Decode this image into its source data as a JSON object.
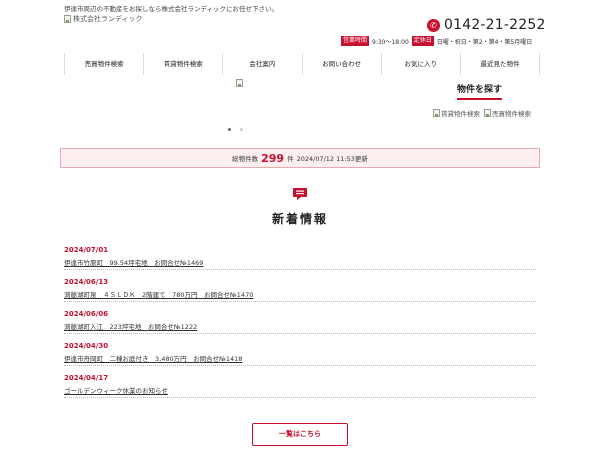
{
  "header": {
    "tagline": "伊達市周辺の不動産をお探しなら株式会社ランディックにお任せ下さい。",
    "logo_alt": "株式会社ランディック",
    "phone": "0142-21-2252",
    "hours_label": "営業時間",
    "hours": "9:30～18:00",
    "closed_label": "定休日",
    "closed_days": "日曜・祝日・第2・第4・第5月曜日"
  },
  "nav": {
    "items": [
      {
        "label": "売買物件検索"
      },
      {
        "label": "賃貸物件検索"
      },
      {
        "label": "会社案内"
      },
      {
        "label": "お問い合わせ"
      },
      {
        "label": "お気に入り"
      },
      {
        "label": "最近見た物件"
      }
    ]
  },
  "search": {
    "title": "物件を探す",
    "rental_link": "賃貸物件検索",
    "sale_link": "売買物件検索"
  },
  "summary": {
    "total_label": "総物件数",
    "total_count": "299",
    "unit": "件",
    "updated": "2024/07/12 11:53更新"
  },
  "news": {
    "title": "新着情報",
    "items": [
      {
        "date": "2024/07/01",
        "text": "伊達市竹原町　99.54坪宅地　お問合せ№1469"
      },
      {
        "date": "2024/06/13",
        "text": "洞爺湖町泉　４ＳＬＤＫ　2階建て　780万円　お問合せ№1470"
      },
      {
        "date": "2024/06/06",
        "text": "洞爺湖町入江　223坪宅地　お問合せ№1222"
      },
      {
        "date": "2024/04/30",
        "text": "伊達市舟岡町　二棟お庭付き　3,480万円　お問合せ№1418"
      },
      {
        "date": "2024/04/17",
        "text": "ゴールデンウィーク休業のお知らせ"
      }
    ],
    "more_label": "一覧はこちら"
  },
  "colors": {
    "accent": "#c8102e",
    "count_bar_bg": "#fdeff0"
  }
}
